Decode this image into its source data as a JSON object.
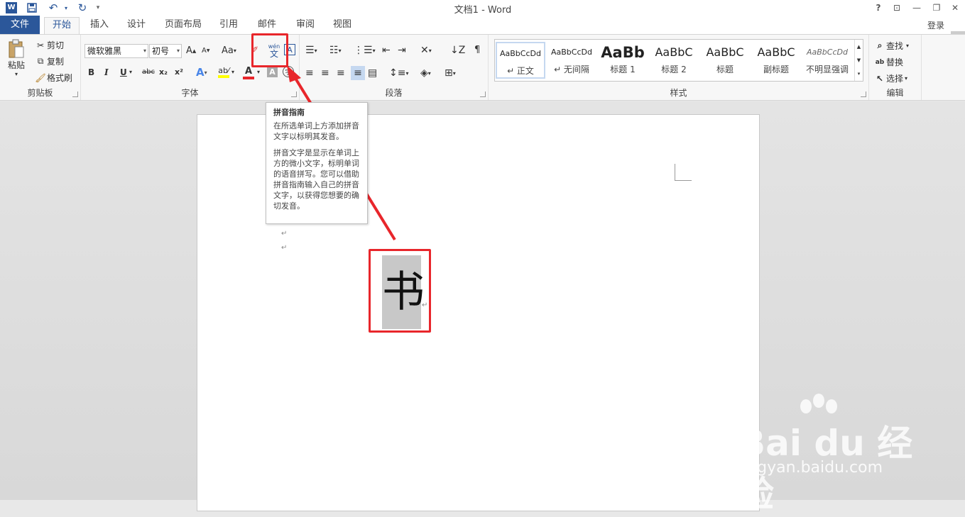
{
  "titlebar": {
    "title": "文档1 - Word",
    "help": "?",
    "ribbon_display": "⊡",
    "minimize": "—",
    "restore": "❐",
    "close": "✕"
  },
  "qat": {
    "word_icon": "W",
    "save_icon": "save-icon",
    "undo_icon": "undo-icon",
    "redo_icon": "redo-icon",
    "customize": "▾"
  },
  "tabs": [
    "文件",
    "开始",
    "插入",
    "设计",
    "页面布局",
    "引用",
    "邮件",
    "审阅",
    "视图"
  ],
  "login": "登录",
  "clipboard": {
    "paste": "粘贴",
    "cut": "剪切",
    "copy": "复制",
    "format_painter": "格式刷",
    "label": "剪贴板"
  },
  "font": {
    "name": "微软雅黑",
    "size": "初号",
    "grow": "A",
    "shrink": "A",
    "case": "Aa",
    "bold": "B",
    "italic": "I",
    "underline": "U",
    "strike": "abc",
    "sub": "x₂",
    "sup": "x²",
    "label": "字体"
  },
  "paragraph": {
    "label": "段落"
  },
  "styles": {
    "items": [
      {
        "sample": "AaBbCcDd",
        "name": "↵ 正文"
      },
      {
        "sample": "AaBbCcDd",
        "name": "↵ 无间隔"
      },
      {
        "sample": "AaBb",
        "name": "标题 1"
      },
      {
        "sample": "AaBbC",
        "name": "标题 2"
      },
      {
        "sample": "AaBbC",
        "name": "标题"
      },
      {
        "sample": "AaBbC",
        "name": "副标题"
      },
      {
        "sample": "AaBbCcDd",
        "name": "不明显强调"
      }
    ],
    "label": "样式"
  },
  "editing": {
    "find": "查找",
    "replace": "替换",
    "select": "选择",
    "label": "编辑"
  },
  "tooltip": {
    "title": "拼音指南",
    "p1": "在所选单词上方添加拼音文字以标明其发音。",
    "p2": "拼音文字是显示在单词上方的微小文字，标明单词的语音拼写。您可以借助拼音指南输入自己的拼音文字，以获得您想要的确切发音。"
  },
  "document": {
    "char": "书",
    "para_mark": "↵"
  },
  "watermark": {
    "brand": "Bai du 经验",
    "url": "jingyan.baidu.com"
  },
  "colors": {
    "accent": "#2b579a",
    "highlight": "#e8262b"
  }
}
